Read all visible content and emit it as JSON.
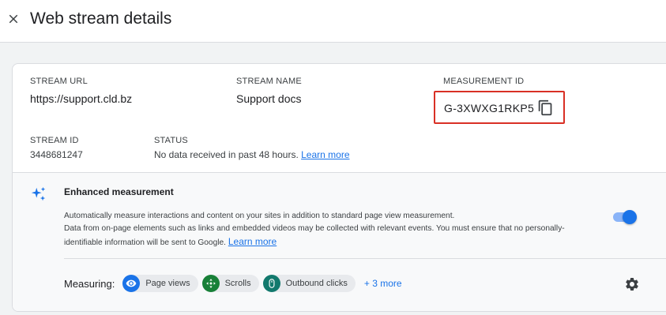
{
  "header": {
    "title": "Web stream details",
    "close_icon": "close-icon"
  },
  "stream": {
    "url_label": "STREAM URL",
    "url_value": "https://support.cld.bz",
    "name_label": "STREAM NAME",
    "name_value": "Support docs",
    "measurement_label": "MEASUREMENT ID",
    "measurement_value": "G-3XWXG1RKP5",
    "copy_icon": "copy-icon",
    "id_label": "STREAM ID",
    "id_value": "3448681247",
    "status_label": "STATUS",
    "status_value": "No data received in past 48 hours.",
    "status_link": "Learn more"
  },
  "enhanced": {
    "icon": "sparkle-icon",
    "title": "Enhanced measurement",
    "desc_line1": "Automatically measure interactions and content on your sites in addition to standard page view measurement.",
    "desc_line2": "Data from on-page elements such as links and embedded videos may be collected with relevant events. You must ensure that no personally-",
    "desc_line3": "identifiable information will be sent to Google.",
    "learn_more": "Learn more",
    "toggle_on": true,
    "measuring_label": "Measuring:",
    "chips": [
      {
        "label": "Page views",
        "icon": "eye-icon",
        "color": "#1a73e8"
      },
      {
        "label": "Scrolls",
        "icon": "scroll-icon",
        "color": "#188038"
      },
      {
        "label": "Outbound clicks",
        "icon": "mouse-icon",
        "color": "#12796d"
      }
    ],
    "more_link": "+ 3 more",
    "settings_icon": "gear-icon"
  },
  "colors": {
    "accent": "#1a73e8",
    "highlight_border": "#d93025"
  }
}
